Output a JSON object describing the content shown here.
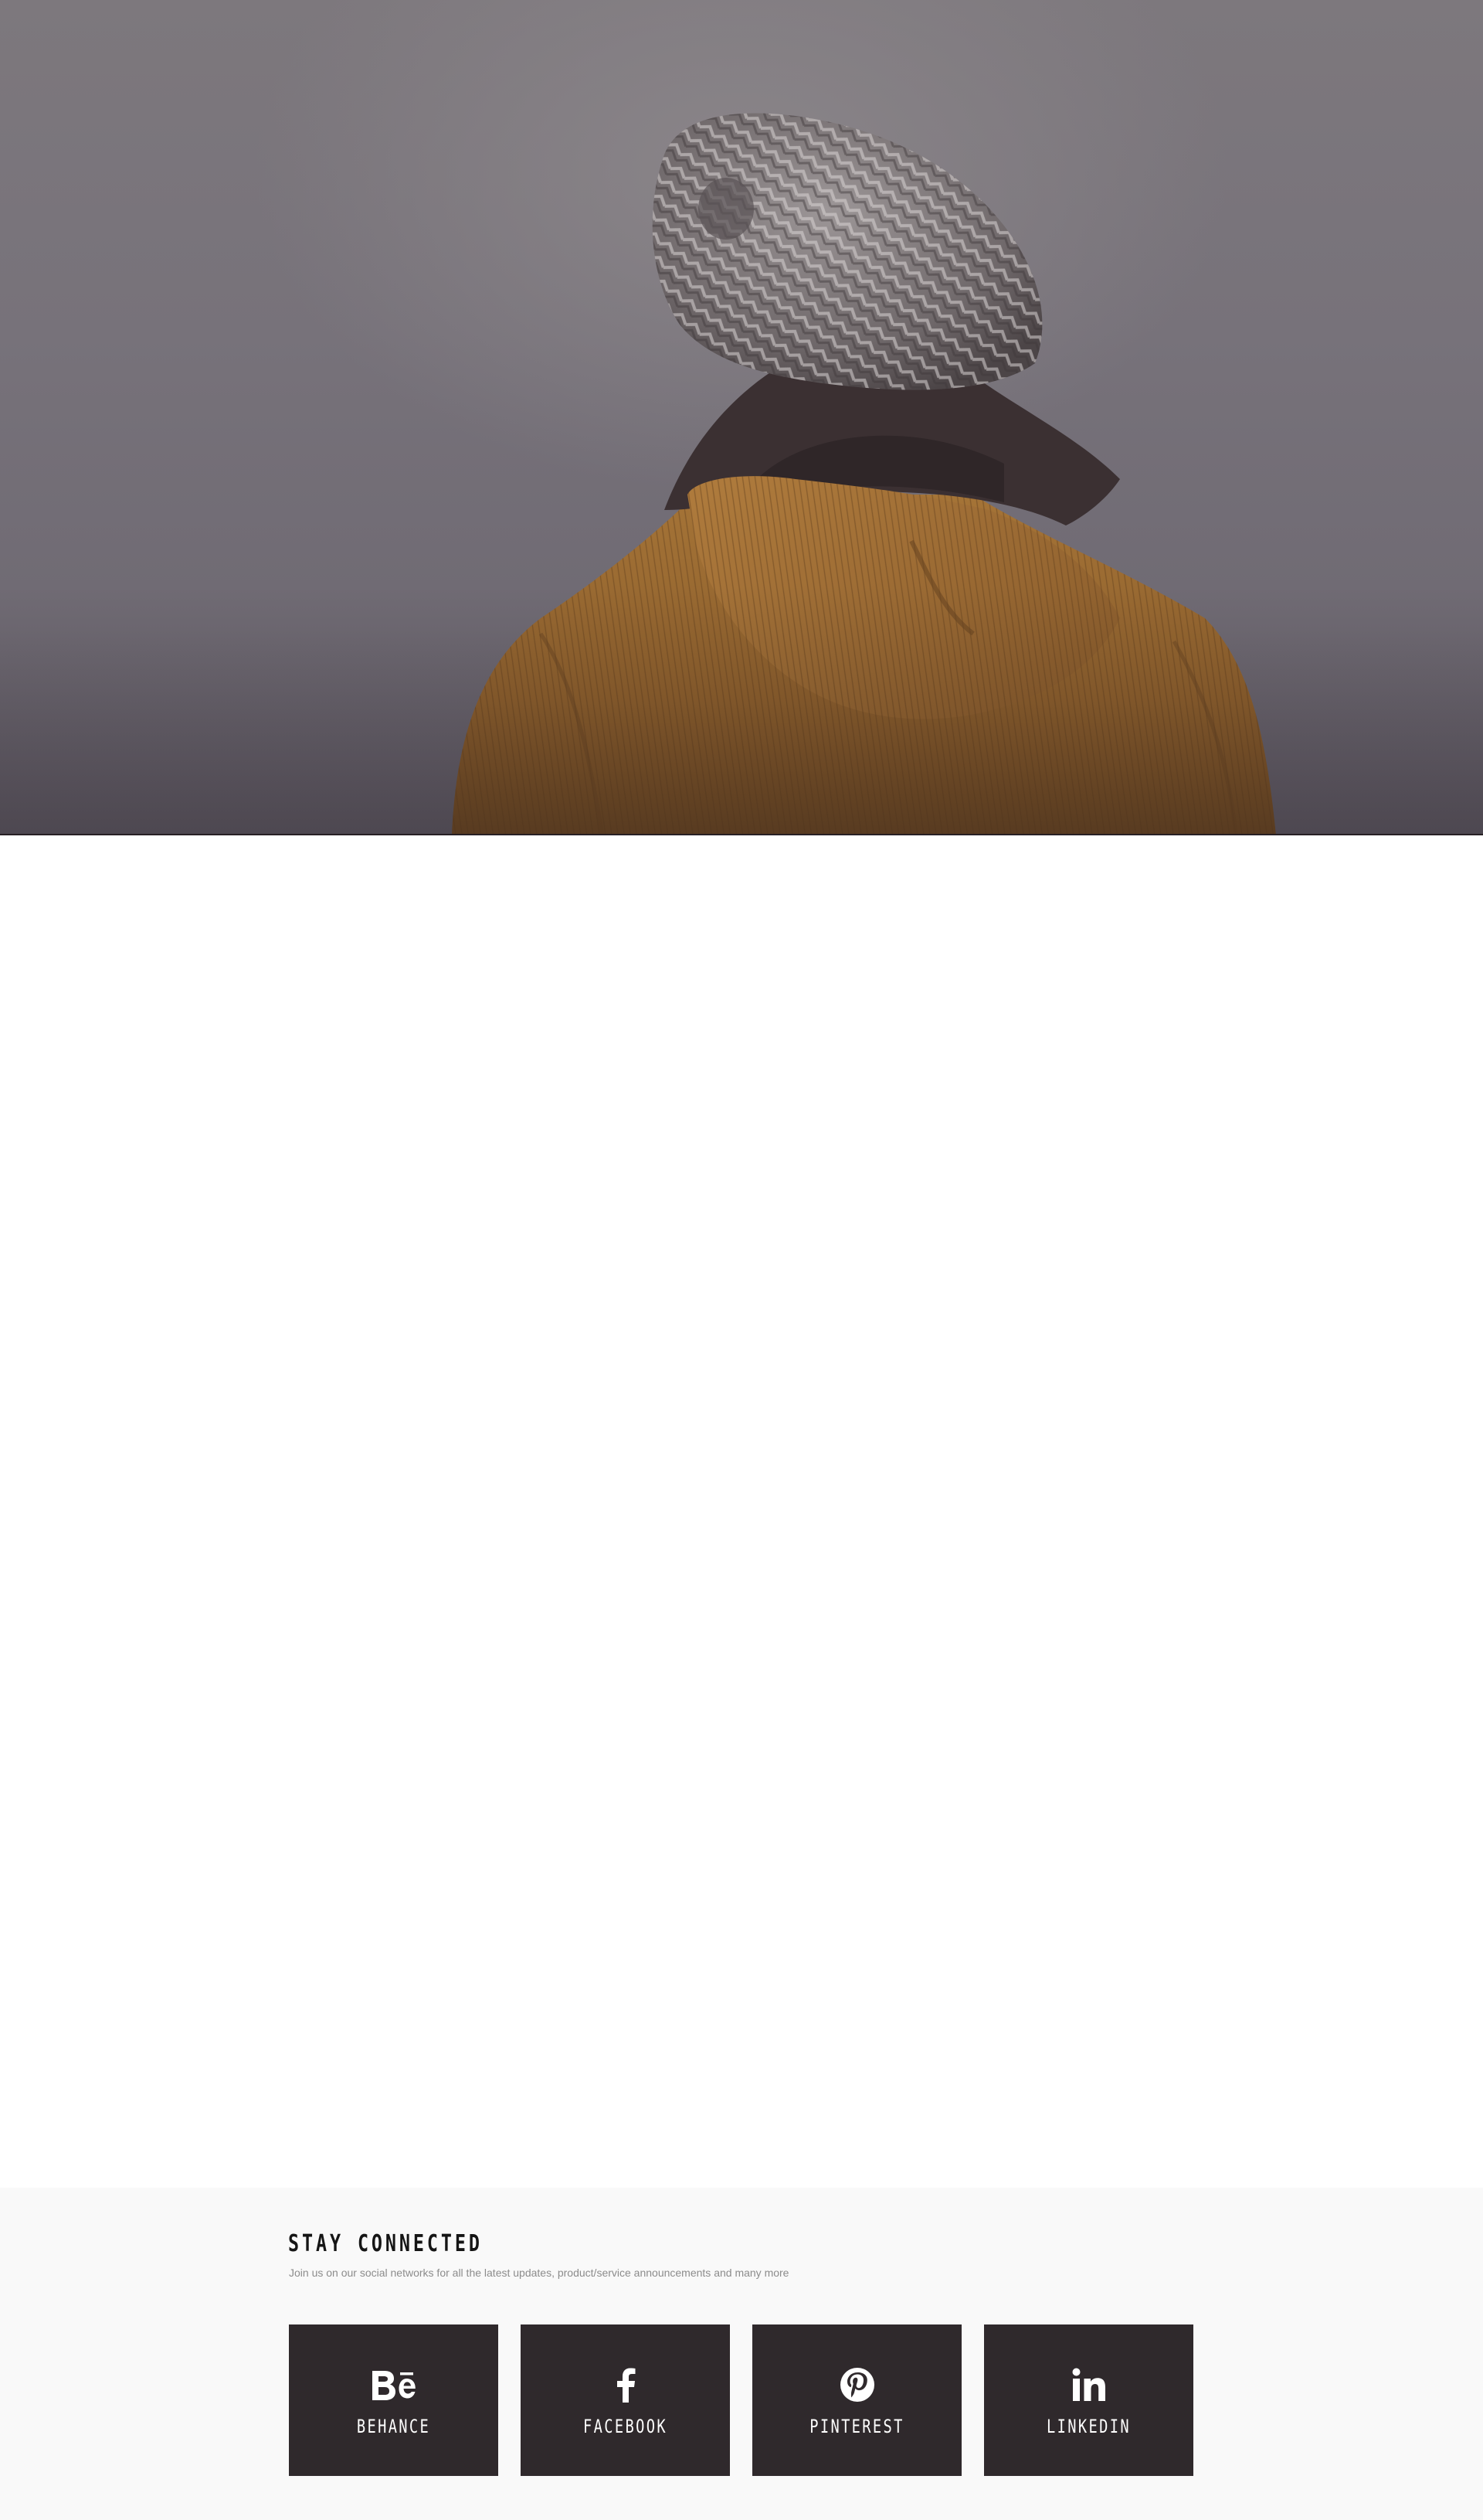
{
  "connect": {
    "title": "STAY CONNECTED",
    "subtitle": "Join us on our social networks for all the latest updates, product/service announcements and many more"
  },
  "social": [
    {
      "label": "BEHANCE",
      "icon": "behance-icon"
    },
    {
      "label": "FACEBOOK",
      "icon": "facebook-icon"
    },
    {
      "label": "PINTEREST",
      "icon": "pinterest-icon"
    },
    {
      "label": "LINKEDIN",
      "icon": "linkedin-icon"
    }
  ],
  "colors": {
    "tile_bg": "#2f292c",
    "section_bg": "#f9f9f9",
    "hero_sky": "#7d787d",
    "coat": "#9a6c34"
  }
}
